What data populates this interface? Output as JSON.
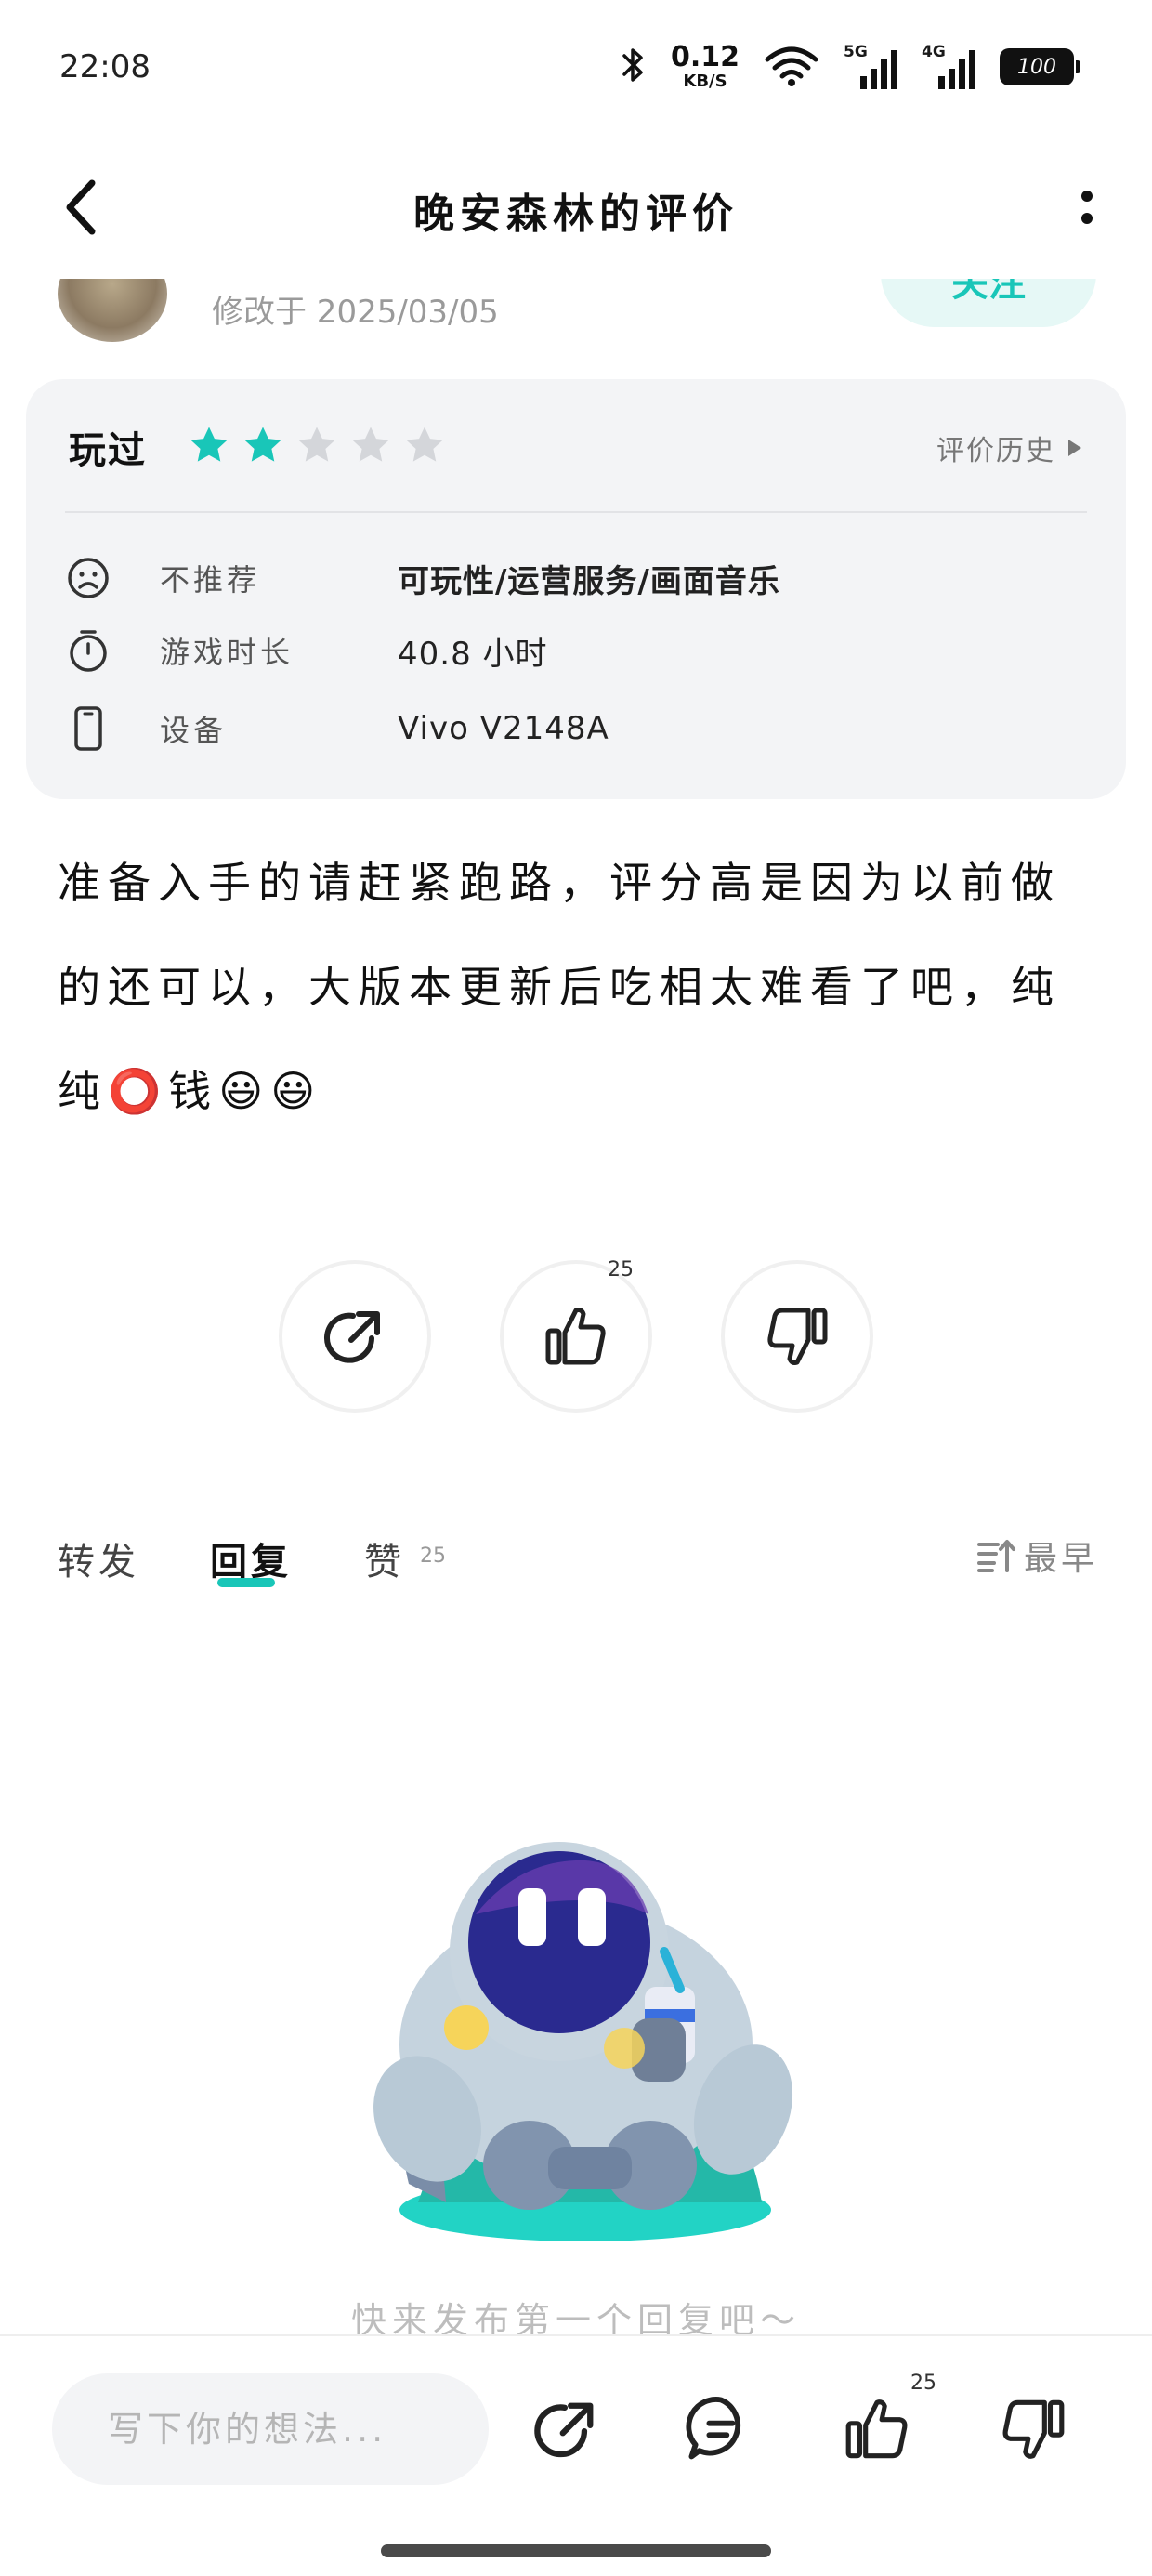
{
  "status_bar": {
    "time": "22:08",
    "net_speed_value": "0.12",
    "net_speed_unit": "KB/S",
    "signal_1_label": "5G",
    "signal_2_label": "4G",
    "battery": "100",
    "icons": [
      "bluetooth-icon",
      "wifi-icon",
      "signal-5g-icon",
      "signal-4g-icon",
      "battery-icon"
    ]
  },
  "header": {
    "title": "晚安森林的评价",
    "back_icon": "chevron-left-icon",
    "more_icon": "vertical-dots-icon"
  },
  "peek": {
    "modified_text": "修改于 2025/03/05",
    "follow_label": "关注"
  },
  "review_card": {
    "played_label": "玩过",
    "rating": 2,
    "rating_max": 5,
    "history_label": "评价历史",
    "rows": [
      {
        "icon": "sad-face-icon",
        "key": "不推荐",
        "value": "可玩性/运营服务/画面音乐"
      },
      {
        "icon": "stopwatch-icon",
        "key": "游戏时长",
        "value": "40.8 小时"
      },
      {
        "icon": "phone-icon",
        "key": "设备",
        "value": "Vivo V2148A"
      }
    ]
  },
  "review_text": "准备入手的请赶紧跑路，评分高是因为以前做的还可以，大版本更新后吃相太难看了吧，纯纯⭕钱😃😃",
  "actions": {
    "like_count": "25"
  },
  "tabs": {
    "items": [
      {
        "label": "转发",
        "active": false
      },
      {
        "label": "回复",
        "active": true
      },
      {
        "label": "赞",
        "active": false
      }
    ],
    "like_count": "25",
    "sort_label": "最早"
  },
  "empty_state": {
    "text": "快来发布第一个回复吧～"
  },
  "bottom_bar": {
    "input_placeholder": "写下你的想法...",
    "like_count": "25"
  },
  "colors": {
    "accent": "#19c6b8",
    "star_inactive": "#d4d6da",
    "card_bg": "#f3f4f6"
  }
}
